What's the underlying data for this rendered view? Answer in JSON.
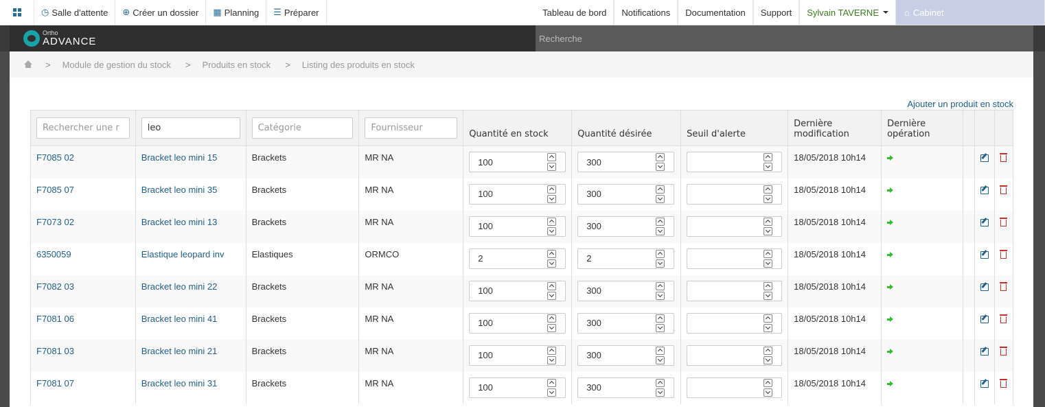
{
  "topnav": {
    "items": [
      {
        "label": "Salle d'attente",
        "icon": "clock-icon"
      },
      {
        "label": "Créer un dossier",
        "icon": "plus-circle-icon"
      },
      {
        "label": "Planning",
        "icon": "calendar-icon"
      },
      {
        "label": "Préparer",
        "icon": "list-icon"
      }
    ],
    "right": [
      {
        "label": "Tableau de bord"
      },
      {
        "label": "Notifications"
      },
      {
        "label": "Documentation"
      },
      {
        "label": "Support"
      }
    ],
    "user": "Sylvain TAVERNE",
    "cabinet": "Cabinet"
  },
  "brand": {
    "small": "Ortho",
    "big": "ADVANCE"
  },
  "search": {
    "placeholder": "Recherche"
  },
  "breadcrumb": [
    "Module de gestion du stock",
    "Produits en stock",
    "Listing des produits en stock"
  ],
  "add_link": "Ajouter un produit en stock",
  "table": {
    "filters": {
      "ref_placeholder": "Rechercher une r",
      "name_value": "leo",
      "category_placeholder": "Catégorie",
      "supplier_placeholder": "Fournisseur"
    },
    "headers": {
      "qty_stock": "Quantité en stock",
      "qty_desired": "Quantité désirée",
      "threshold": "Seuil d'alerte",
      "last_modif": "Dernière modification",
      "last_op": "Dernière opération"
    },
    "rows": [
      {
        "ref": "F7085 02",
        "name": "Bracket leo mini 15",
        "category": "Brackets",
        "supplier": "MR NA",
        "stock": "100",
        "desired": "300",
        "threshold": "",
        "date": "18/05/2018 10h14"
      },
      {
        "ref": "F7085 07",
        "name": "Bracket leo mini 35",
        "category": "Brackets",
        "supplier": "MR NA",
        "stock": "100",
        "desired": "300",
        "threshold": "",
        "date": "18/05/2018 10h14"
      },
      {
        "ref": "F7073 02",
        "name": "Bracket leo mini 13",
        "category": "Brackets",
        "supplier": "MR NA",
        "stock": "100",
        "desired": "300",
        "threshold": "",
        "date": "18/05/2018 10h14"
      },
      {
        "ref": "6350059",
        "name": "Elastique leopard inv",
        "category": "Elastiques",
        "supplier": "ORMCO",
        "stock": "2",
        "desired": "2",
        "threshold": "",
        "date": "18/05/2018 10h14"
      },
      {
        "ref": "F7082 03",
        "name": "Bracket leo mini 22",
        "category": "Brackets",
        "supplier": "MR NA",
        "stock": "100",
        "desired": "300",
        "threshold": "",
        "date": "18/05/2018 10h14"
      },
      {
        "ref": "F7081 06",
        "name": "Bracket leo mini 41",
        "category": "Brackets",
        "supplier": "MR NA",
        "stock": "100",
        "desired": "300",
        "threshold": "",
        "date": "18/05/2018 10h14"
      },
      {
        "ref": "F7081 03",
        "name": "Bracket leo mini 21",
        "category": "Brackets",
        "supplier": "MR NA",
        "stock": "100",
        "desired": "300",
        "threshold": "",
        "date": "18/05/2018 10h14"
      },
      {
        "ref": "F7081 07",
        "name": "Bracket leo mini 31",
        "category": "Brackets",
        "supplier": "MR NA",
        "stock": "100",
        "desired": "300",
        "threshold": "",
        "date": "18/05/2018 10h14"
      }
    ]
  }
}
